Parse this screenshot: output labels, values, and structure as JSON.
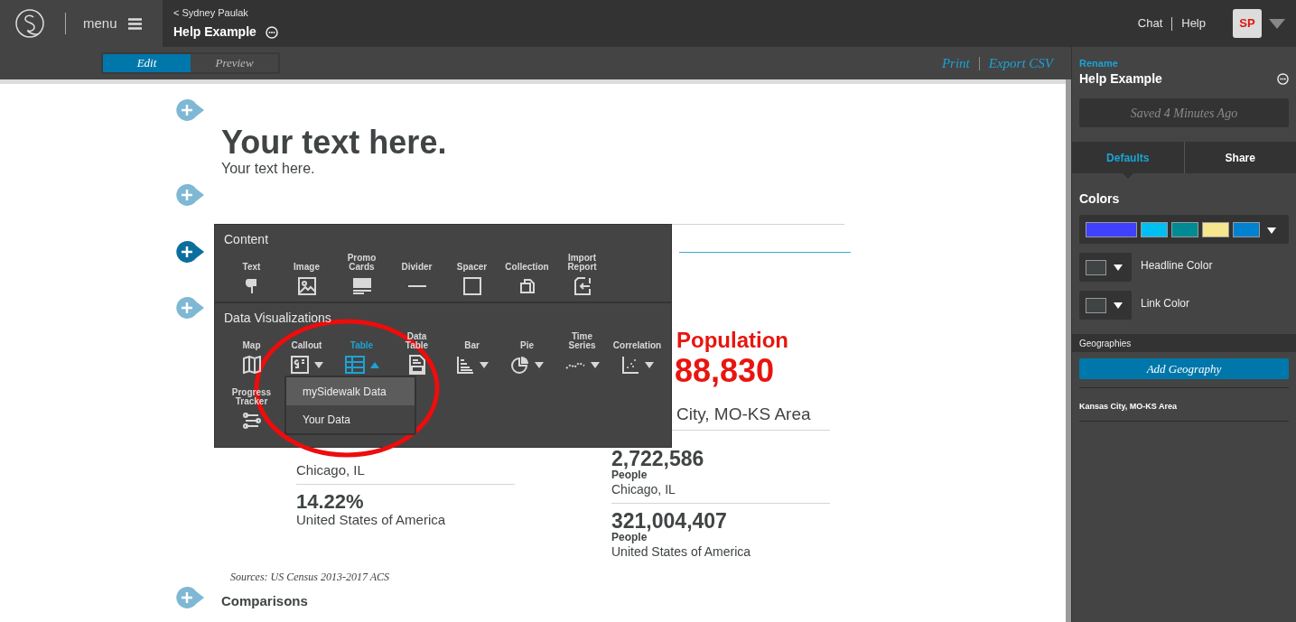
{
  "header": {
    "menu_label": "menu",
    "back_link": "< Sydney Paulak",
    "title": "Help Example",
    "links": [
      "Chat",
      "Help"
    ],
    "avatar": "SP"
  },
  "toolbar": {
    "modes": [
      {
        "label": "Edit",
        "selected": true
      },
      {
        "label": "Preview",
        "selected": false
      }
    ],
    "actions": [
      "Print",
      "Export CSV"
    ]
  },
  "canvas": {
    "headline": "Your text here.",
    "subtext": "Your text here.",
    "right_stat": {
      "title": "Population",
      "value": "88,830",
      "place": "City, MO-KS Area",
      "rows": [
        {
          "value": "2,722,586",
          "unit": "People",
          "place": "Chicago, IL"
        },
        {
          "value": "321,004,407",
          "unit": "People",
          "place": "United States of America"
        }
      ]
    },
    "left_stat": {
      "rows": [
        {
          "value": null,
          "place": "Chicago, IL"
        },
        {
          "value": "14.22%",
          "place": "United States of America"
        }
      ]
    },
    "sources": "Sources: US Census 2013-2017 ACS",
    "next_heading": "Comparisons"
  },
  "insert_menu": {
    "sections": [
      {
        "title": "Content",
        "items": [
          {
            "label": "Text",
            "selected": false
          },
          {
            "label": "Image",
            "selected": false
          },
          {
            "label": "Promo Cards",
            "selected": false
          },
          {
            "label": "Divider",
            "selected": false
          },
          {
            "label": "Spacer",
            "selected": false
          },
          {
            "label": "Collection",
            "selected": false
          },
          {
            "label": "Import Report",
            "selected": false
          }
        ]
      },
      {
        "title": "Data Visualizations",
        "items": [
          {
            "label": "Map",
            "selected": false
          },
          {
            "label": "Callout",
            "selected": false,
            "expanded": false
          },
          {
            "label": "Table",
            "selected": true,
            "expanded": true
          },
          {
            "label": "Data Table",
            "selected": false
          },
          {
            "label": "Bar",
            "selected": false,
            "expanded": false
          },
          {
            "label": "Pie",
            "selected": false,
            "expanded": false
          },
          {
            "label": "Time Series",
            "selected": false,
            "expanded": false
          },
          {
            "label": "Correlation",
            "selected": false,
            "expanded": false
          },
          {
            "label": "Progress Tracker",
            "selected": false
          }
        ]
      }
    ],
    "submenu": [
      {
        "label": "mySidewalk Data",
        "selected": true
      },
      {
        "label": "Your Data",
        "selected": false
      }
    ]
  },
  "side_panel": {
    "rename": "Rename",
    "title": "Help Example",
    "saved": "Saved 4 Minutes Ago",
    "tabs": [
      {
        "label": "Defaults",
        "selected": true
      },
      {
        "label": "Share",
        "selected": false
      }
    ],
    "colors_title": "Colors",
    "palette": [
      {
        "color": "#4040ff"
      },
      {
        "color": "#00bff2"
      },
      {
        "color": "#008a94"
      },
      {
        "color": "#f5e68f"
      },
      {
        "color": "#0082d0"
      }
    ],
    "color_settings": [
      {
        "label": "Headline Color",
        "color": "#3f4444"
      },
      {
        "label": "Link Color",
        "color": "#3f4444"
      }
    ],
    "geographies_title": "Geographies",
    "add_button": "Add Geography",
    "geographies": [
      "Kansas City, MO-KS Area"
    ]
  }
}
